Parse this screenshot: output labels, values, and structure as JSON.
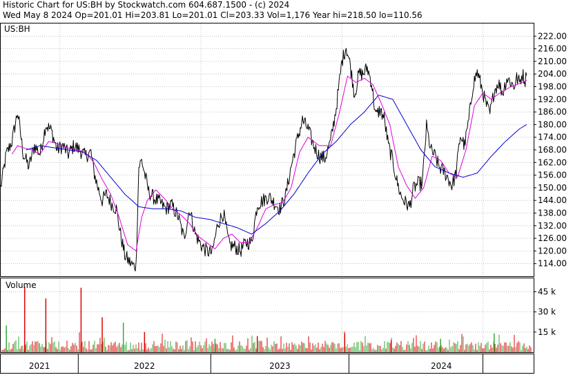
{
  "header": {
    "line1": "Historic Chart for US:BH by Stockwatch.com 604.687.1500 - (c) 2024",
    "line2": "Wed May  8 2024   Op=201.01  Hi=203.81  Lo=201.01  Cl=203.33  Vol=1,176  Year hi=218.50  lo=110.56"
  },
  "chart_data": {
    "type": "line",
    "symbol_label": "US:BH",
    "volume_label": "Volume",
    "price_axis": {
      "ticks": [
        "222.00",
        "216.00",
        "210.00",
        "204.00",
        "198.00",
        "192.00",
        "186.00",
        "180.00",
        "174.00",
        "168.00",
        "162.00",
        "156.00",
        "150.00",
        "144.00",
        "138.00",
        "132.00",
        "126.00",
        "120.00",
        "114.00"
      ],
      "ylim": [
        108,
        228
      ],
      "grid": true
    },
    "volume_axis": {
      "ticks": [
        "45 k",
        "30 k",
        "15 k"
      ],
      "ylim": [
        0,
        55000
      ]
    },
    "x_axis": {
      "labels": [
        "2021",
        "2022",
        "2023",
        "2024"
      ],
      "xlim": [
        2020.58,
        2024.36
      ]
    },
    "colors": {
      "price": "#000000",
      "ma_short": "#dd00dd",
      "ma_long": "#0000cc",
      "vol_up": "#33aa33",
      "vol_down": "#dd0000",
      "grid": "#b0b0b0",
      "frame": "#000000"
    },
    "series": [
      {
        "key": "price",
        "points": [
          [
            2020.58,
            150
          ],
          [
            2020.62,
            166
          ],
          [
            2020.66,
            172
          ],
          [
            2020.7,
            186
          ],
          [
            2020.74,
            166
          ],
          [
            2020.78,
            160
          ],
          [
            2020.82,
            170
          ],
          [
            2020.86,
            166
          ],
          [
            2020.9,
            180
          ],
          [
            2020.94,
            177
          ],
          [
            2020.98,
            168
          ],
          [
            2021.02,
            170
          ],
          [
            2021.06,
            166
          ],
          [
            2021.1,
            170
          ],
          [
            2021.14,
            168
          ],
          [
            2021.18,
            165
          ],
          [
            2021.22,
            167
          ],
          [
            2021.24,
            158
          ],
          [
            2021.27,
            150
          ],
          [
            2021.3,
            144
          ],
          [
            2021.33,
            147
          ],
          [
            2021.37,
            142
          ],
          [
            2021.4,
            140
          ],
          [
            2021.43,
            128
          ],
          [
            2021.46,
            118
          ],
          [
            2021.49,
            115
          ],
          [
            2021.52,
            113
          ],
          [
            2021.54,
            113
          ],
          [
            2021.56,
            160
          ],
          [
            2021.58,
            163
          ],
          [
            2021.6,
            157
          ],
          [
            2021.63,
            148
          ],
          [
            2021.67,
            145
          ],
          [
            2021.71,
            143
          ],
          [
            2021.75,
            140
          ],
          [
            2021.79,
            142
          ],
          [
            2021.84,
            136
          ],
          [
            2021.88,
            126
          ],
          [
            2021.92,
            140
          ],
          [
            2021.96,
            128
          ],
          [
            2022.0,
            123
          ],
          [
            2022.04,
            120
          ],
          [
            2022.08,
            119
          ],
          [
            2022.12,
            133
          ],
          [
            2022.16,
            138
          ],
          [
            2022.2,
            123
          ],
          [
            2022.24,
            122
          ],
          [
            2022.28,
            120
          ],
          [
            2022.32,
            124
          ],
          [
            2022.36,
            124
          ],
          [
            2022.4,
            142
          ],
          [
            2022.44,
            144
          ],
          [
            2022.48,
            146
          ],
          [
            2022.52,
            143
          ],
          [
            2022.56,
            140
          ],
          [
            2022.6,
            146
          ],
          [
            2022.64,
            160
          ],
          [
            2022.68,
            172
          ],
          [
            2022.72,
            182
          ],
          [
            2022.76,
            178
          ],
          [
            2022.8,
            170
          ],
          [
            2022.84,
            165
          ],
          [
            2022.88,
            164
          ],
          [
            2022.92,
            172
          ],
          [
            2022.96,
            188
          ],
          [
            2023.0,
            210
          ],
          [
            2023.03,
            217
          ],
          [
            2023.06,
            208
          ],
          [
            2023.09,
            194
          ],
          [
            2023.12,
            204
          ],
          [
            2023.15,
            204
          ],
          [
            2023.18,
            207
          ],
          [
            2023.21,
            200
          ],
          [
            2023.24,
            184
          ],
          [
            2023.27,
            187
          ],
          [
            2023.3,
            183
          ],
          [
            2023.33,
            170
          ],
          [
            2023.36,
            163
          ],
          [
            2023.39,
            153
          ],
          [
            2023.42,
            146
          ],
          [
            2023.45,
            143
          ],
          [
            2023.48,
            141
          ],
          [
            2023.51,
            150
          ],
          [
            2023.54,
            152
          ],
          [
            2023.57,
            152
          ],
          [
            2023.6,
            179
          ],
          [
            2023.63,
            168
          ],
          [
            2023.66,
            165
          ],
          [
            2023.69,
            160
          ],
          [
            2023.72,
            158
          ],
          [
            2023.75,
            155
          ],
          [
            2023.78,
            151
          ],
          [
            2023.81,
            157
          ],
          [
            2023.84,
            175
          ],
          [
            2023.87,
            170
          ],
          [
            2023.9,
            182
          ],
          [
            2023.93,
            199
          ],
          [
            2023.96,
            205
          ],
          [
            2023.99,
            198
          ],
          [
            2024.02,
            190
          ],
          [
            2024.05,
            185
          ],
          [
            2024.08,
            196
          ],
          [
            2024.11,
            200
          ],
          [
            2024.14,
            195
          ],
          [
            2024.17,
            202
          ],
          [
            2024.2,
            200
          ],
          [
            2024.22,
            198
          ],
          [
            2024.24,
            202
          ],
          [
            2024.26,
            200
          ],
          [
            2024.28,
            204
          ],
          [
            2024.3,
            201
          ],
          [
            2024.31,
            203.3
          ]
        ]
      },
      {
        "key": "ma_short",
        "points": [
          [
            2020.66,
            166
          ],
          [
            2020.7,
            170
          ],
          [
            2020.74,
            169
          ],
          [
            2020.8,
            168
          ],
          [
            2020.86,
            166
          ],
          [
            2020.92,
            172
          ],
          [
            2020.98,
            171
          ],
          [
            2021.05,
            169
          ],
          [
            2021.12,
            168
          ],
          [
            2021.18,
            167
          ],
          [
            2021.24,
            162
          ],
          [
            2021.3,
            154
          ],
          [
            2021.36,
            147
          ],
          [
            2021.42,
            136
          ],
          [
            2021.48,
            123
          ],
          [
            2021.54,
            120
          ],
          [
            2021.58,
            136
          ],
          [
            2021.62,
            144
          ],
          [
            2021.68,
            149
          ],
          [
            2021.74,
            145
          ],
          [
            2021.8,
            140
          ],
          [
            2021.86,
            137
          ],
          [
            2021.92,
            133
          ],
          [
            2021.98,
            127
          ],
          [
            2022.04,
            124
          ],
          [
            2022.1,
            121
          ],
          [
            2022.16,
            126
          ],
          [
            2022.22,
            128
          ],
          [
            2022.28,
            124
          ],
          [
            2022.34,
            124
          ],
          [
            2022.4,
            131
          ],
          [
            2022.46,
            140
          ],
          [
            2022.52,
            142
          ],
          [
            2022.58,
            143
          ],
          [
            2022.64,
            150
          ],
          [
            2022.7,
            167
          ],
          [
            2022.76,
            174
          ],
          [
            2022.84,
            170
          ],
          [
            2022.92,
            170
          ],
          [
            2022.98,
            185
          ],
          [
            2023.04,
            203
          ],
          [
            2023.1,
            200
          ],
          [
            2023.16,
            202
          ],
          [
            2023.22,
            199
          ],
          [
            2023.28,
            190
          ],
          [
            2023.34,
            180
          ],
          [
            2023.4,
            160
          ],
          [
            2023.46,
            151
          ],
          [
            2023.52,
            145
          ],
          [
            2023.58,
            150
          ],
          [
            2023.64,
            165
          ],
          [
            2023.7,
            163
          ],
          [
            2023.76,
            157
          ],
          [
            2023.82,
            155
          ],
          [
            2023.88,
            168
          ],
          [
            2023.94,
            189
          ],
          [
            2024.0,
            195
          ],
          [
            2024.06,
            192
          ],
          [
            2024.12,
            195
          ],
          [
            2024.2,
            198
          ],
          [
            2024.28,
            200
          ],
          [
            2024.31,
            201
          ]
        ]
      },
      {
        "key": "ma_long",
        "points": [
          [
            2020.76,
            168
          ],
          [
            2020.86,
            170
          ],
          [
            2020.96,
            169
          ],
          [
            2021.06,
            168
          ],
          [
            2021.16,
            167
          ],
          [
            2021.26,
            163
          ],
          [
            2021.36,
            155
          ],
          [
            2021.46,
            147
          ],
          [
            2021.56,
            141
          ],
          [
            2021.66,
            140
          ],
          [
            2021.76,
            140
          ],
          [
            2021.86,
            139
          ],
          [
            2021.96,
            136
          ],
          [
            2022.06,
            135
          ],
          [
            2022.16,
            133
          ],
          [
            2022.26,
            131
          ],
          [
            2022.36,
            128
          ],
          [
            2022.46,
            133
          ],
          [
            2022.56,
            139
          ],
          [
            2022.66,
            147
          ],
          [
            2022.76,
            157
          ],
          [
            2022.86,
            166
          ],
          [
            2022.96,
            172
          ],
          [
            2023.06,
            180
          ],
          [
            2023.16,
            186
          ],
          [
            2023.26,
            194
          ],
          [
            2023.36,
            192
          ],
          [
            2023.46,
            180
          ],
          [
            2023.56,
            168
          ],
          [
            2023.66,
            160
          ],
          [
            2023.76,
            157
          ],
          [
            2023.86,
            155
          ],
          [
            2023.96,
            157
          ],
          [
            2024.06,
            165
          ],
          [
            2024.16,
            172
          ],
          [
            2024.26,
            178
          ],
          [
            2024.31,
            180
          ]
        ]
      }
    ],
    "volume": {
      "spikes": [
        [
          2020.62,
          20000,
          "up"
        ],
        [
          2020.75,
          49000,
          "down"
        ],
        [
          2020.9,
          40000,
          "down"
        ],
        [
          2021.15,
          48000,
          "down"
        ],
        [
          2021.3,
          26000,
          "down"
        ],
        [
          2021.45,
          22000,
          "up"
        ],
        [
          2021.6,
          15000,
          "down"
        ],
        [
          2022.1,
          10000,
          "up"
        ],
        [
          2022.4,
          12000,
          "down"
        ],
        [
          2023.02,
          14000,
          "down"
        ],
        [
          2023.35,
          9000,
          "down"
        ],
        [
          2023.7,
          10000,
          "up"
        ],
        [
          2024.08,
          14000,
          "up"
        ]
      ]
    }
  }
}
